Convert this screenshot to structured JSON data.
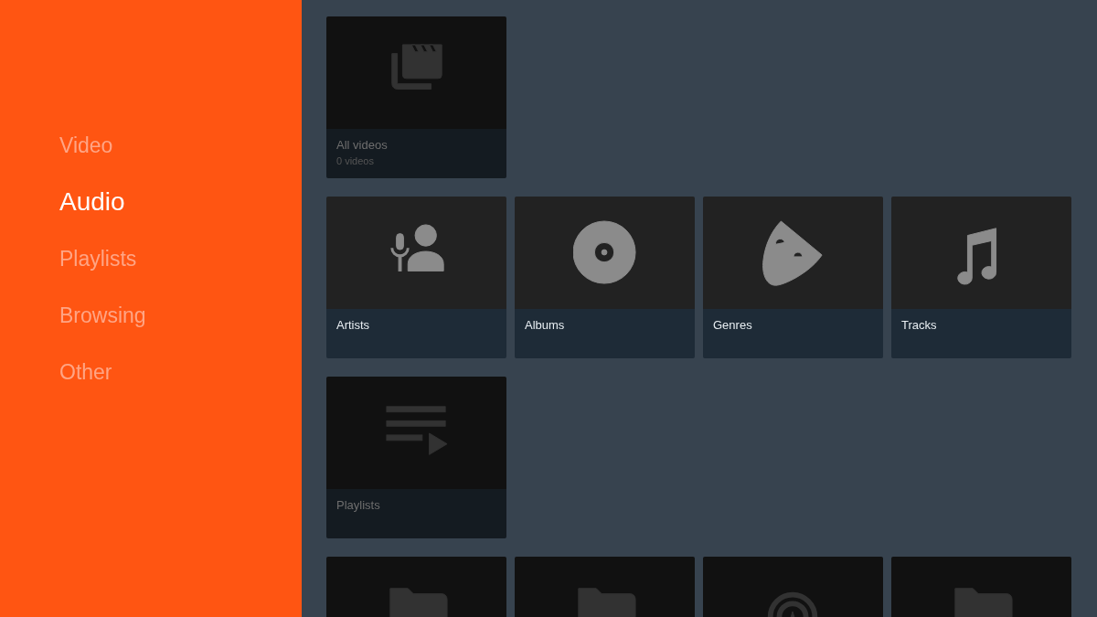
{
  "sidebar": {
    "items": [
      {
        "label": "Video",
        "selected": false
      },
      {
        "label": "Audio",
        "selected": true
      },
      {
        "label": "Playlists",
        "selected": false
      },
      {
        "label": "Browsing",
        "selected": false
      },
      {
        "label": "Other",
        "selected": false
      }
    ]
  },
  "sections": [
    {
      "focused": false,
      "cards": [
        {
          "kind": "videos",
          "title": "All videos",
          "subtitle": "0 videos"
        }
      ]
    },
    {
      "focused": true,
      "cards": [
        {
          "kind": "artists",
          "title": "Artists"
        },
        {
          "kind": "albums",
          "title": "Albums"
        },
        {
          "kind": "genres",
          "title": "Genres"
        },
        {
          "kind": "tracks",
          "title": "Tracks"
        }
      ]
    },
    {
      "focused": false,
      "cards": [
        {
          "kind": "playlists",
          "title": "Playlists"
        }
      ]
    },
    {
      "focused": false,
      "cards": [
        {
          "kind": "folder"
        },
        {
          "kind": "network-folder"
        },
        {
          "kind": "stream"
        },
        {
          "kind": "add-network-folder"
        }
      ]
    }
  ]
}
